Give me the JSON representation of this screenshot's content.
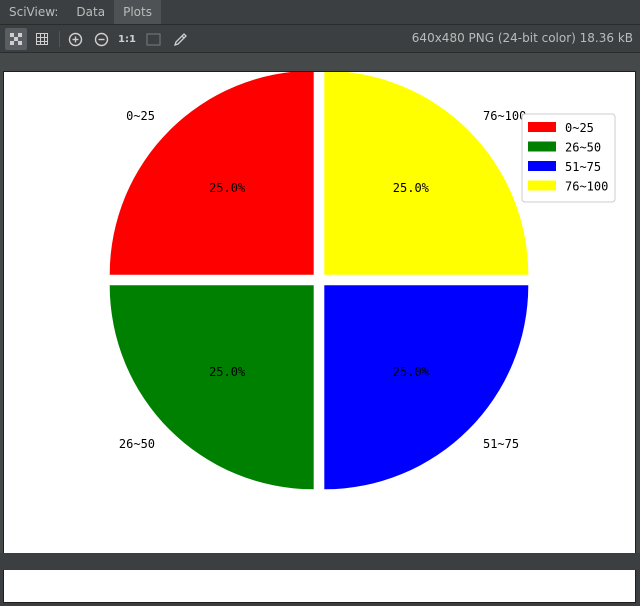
{
  "tabbar": {
    "label": "SciView:",
    "tabs": [
      {
        "label": "Data",
        "active": false
      },
      {
        "label": "Plots",
        "active": true
      }
    ]
  },
  "toolbar": {
    "zoom_one_label": "1:1",
    "image_info": "640x480 PNG (24-bit color) 18.36 kB",
    "icons": [
      "chessboard-icon",
      "grid-icon",
      "zoom-in-icon",
      "zoom-out-icon",
      "actual-size-icon",
      "fit-window-icon",
      "color-picker-icon"
    ]
  },
  "chart_data": {
    "type": "pie",
    "title": "",
    "categories": [
      "0~25",
      "26~50",
      "51~75",
      "76~100"
    ],
    "values": [
      25,
      25,
      25,
      25
    ],
    "percent_labels": [
      "25.0%",
      "25.0%",
      "25.0%",
      "25.0%"
    ],
    "colors": [
      "#ff0000",
      "#008000",
      "#0000ff",
      "#ffff00"
    ],
    "explode": [
      0.05,
      0.05,
      0.05,
      0.05
    ],
    "startangle_deg": 90,
    "legend": {
      "placement": "top-right",
      "entries": [
        "0~25",
        "26~50",
        "51~75",
        "76~100"
      ]
    }
  }
}
